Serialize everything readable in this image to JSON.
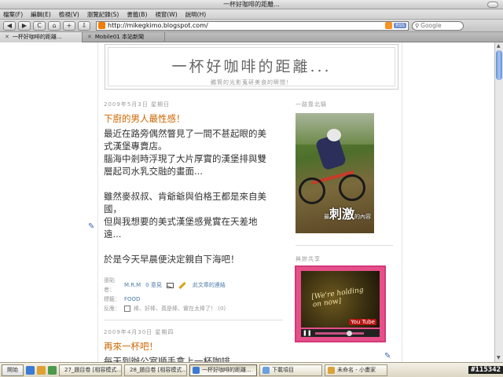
{
  "window": {
    "title": "一杯好咖啡的距離..."
  },
  "menu": [
    "檔案(F)",
    "編輯(E)",
    "檢視(V)",
    "瀏覽記錄(S)",
    "書籤(B)",
    "視窗(W)",
    "說明(H)"
  ],
  "toolbar": {
    "back": "◀",
    "forward": "▶",
    "reload": "C",
    "home": "⌂",
    "add": "+",
    "download": "⇩",
    "url": "http://mikegkimo.blogspot.com/",
    "rss": "RSS",
    "search_placeholder": "Google"
  },
  "tabs": [
    {
      "label": "一杯好咖啡的距離...",
      "active": true
    },
    {
      "label": "Mobile01 本站新聞",
      "active": false
    }
  ],
  "blog": {
    "title": "一杯好咖啡的距離...",
    "description": "觸筒的光影蒐研美食的瞬間！"
  },
  "post1": {
    "date": "2009年5月3日 星期日",
    "title": "下廚的男人最性感！",
    "lines": [
      "最近在路旁偶然瞥見了一間不甚起眼的美",
      "式漢堡專賣店。",
      "腦海中剎時浮現了大片厚實的漢堡排與雙",
      "層起司水乳交融的畫面...",
      "",
      "雖然麥叔叔、肯爺爺與伯格王都是來自美",
      "國，",
      "但與我想要的美式漢堡感覺實在天差地",
      "遠...",
      "",
      "於是今天早晨便決定親自下海吧！"
    ],
    "footer": {
      "author_label": "張貼者：",
      "author": "M.R.M",
      "comments": "0 意見",
      "link_label": "此文章的連結",
      "tags_label": "標籤：",
      "tag": "FOOD",
      "reaction_label": "反應：",
      "reaction_text": "棒、好棒、真是棒、實在太棒了！ (0)"
    }
  },
  "post2": {
    "date": "2009年4月30日 星期四",
    "title": "再來一杯吧！",
    "line1": "每天到辦公室順手拿上一杯咖啡，"
  },
  "sidebar": {
    "photo_head": "一路靠北騎",
    "photo_caption_small1": "最",
    "photo_caption_big": "刺激",
    "photo_caption_small2": "的內容",
    "video_head": "與妳共享",
    "video_text_line1": "[We're holding",
    "video_text_line2": "on now]",
    "video_logo": "You Tube",
    "video_progress": 0.7
  },
  "taskbar": {
    "start": "開始",
    "items": [
      {
        "label": "27_題目卷 [相容模式...",
        "active": false
      },
      {
        "label": "28_題目卷 [相容模式...",
        "active": false
      },
      {
        "label": "一杯好咖啡的距離...",
        "active": true
      },
      {
        "label": "下載項目",
        "active": false
      },
      {
        "label": "未命名 - 小畫家",
        "active": false
      }
    ],
    "badge": "#115342"
  },
  "colors": {
    "post_title": "#cc6600",
    "link": "#4a7aa7",
    "video_frame": "#e64f8a"
  }
}
